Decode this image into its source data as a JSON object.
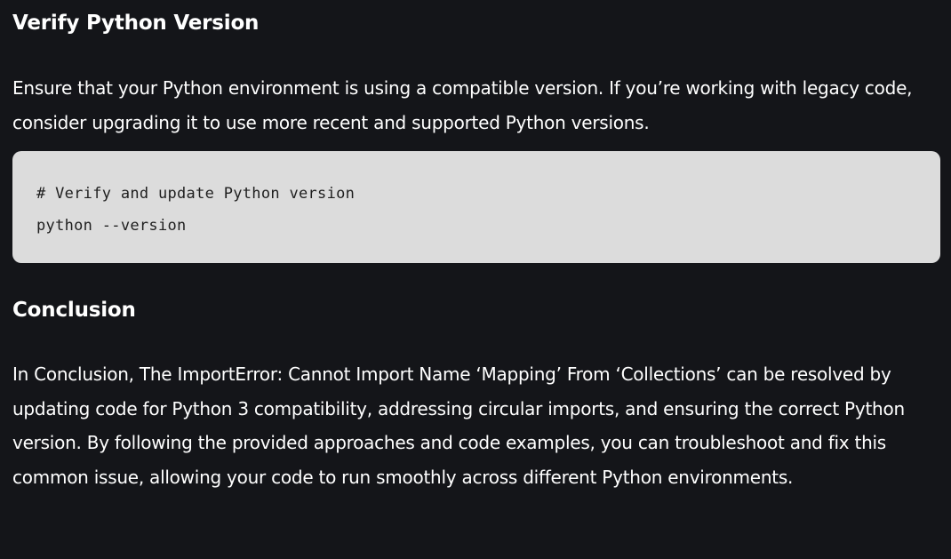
{
  "section1": {
    "heading": "Verify Python Version",
    "paragraph": "Ensure that your Python environment is using a compatible version. If you’re working with legacy code, consider upgrading it to use more recent and supported Python versions.",
    "code_lines": [
      "# Verify and update Python version",
      "python --version"
    ]
  },
  "section2": {
    "heading": "Conclusion",
    "paragraph": "In Conclusion, The ImportError: Cannot Import Name ‘Mapping’ From ‘Collections’ can be resolved by updating code for Python 3 compatibility, addressing circular imports, and ensuring the correct Python version. By following the provided approaches and code examples, you can troubleshoot and fix this common issue, allowing your code to run smoothly across different Python environments."
  }
}
